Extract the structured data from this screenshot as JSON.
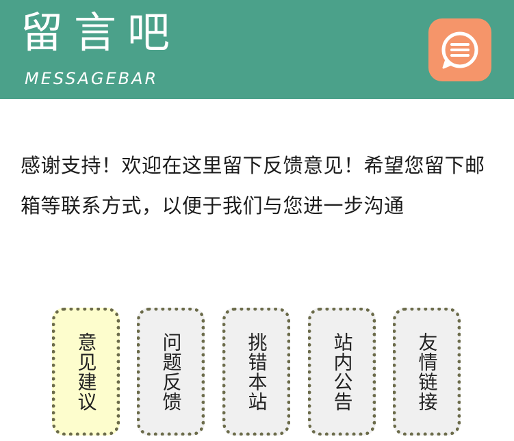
{
  "header": {
    "logo_cn": "留言吧",
    "logo_en": "MESSAGEBAR",
    "message_button_icon": "message-bubble-icon",
    "background_color": "#4ba18a",
    "accent_color": "#f5956a"
  },
  "intro_text": "感谢支持！欢迎在这里留下反馈意见！希望您留下邮箱等联系方式，以便于我们与您进一步沟通",
  "nav": {
    "items": [
      {
        "label": "意见建议",
        "active": true
      },
      {
        "label": "问题反馈",
        "active": false
      },
      {
        "label": "挑错本站",
        "active": false
      },
      {
        "label": "站内公告",
        "active": false
      },
      {
        "label": "友情链接",
        "active": false
      }
    ],
    "active_color": "#fdfdcd",
    "inactive_color": "#f0f0f0"
  }
}
